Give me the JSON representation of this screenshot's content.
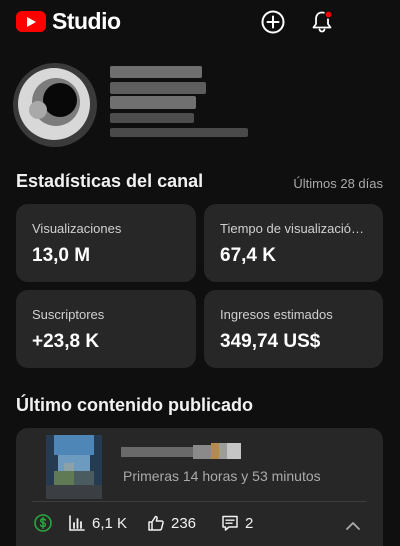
{
  "app": {
    "logo_text": "Studio"
  },
  "header": {
    "create_icon": "plus-circle-icon",
    "notifications_icon": "bell-icon",
    "notification_dot_color": "#ff0000"
  },
  "analytics": {
    "title": "Estadísticas del canal",
    "range": "Últimos 28 días",
    "cards": [
      {
        "label": "Visualizaciones",
        "value": "13,0 M"
      },
      {
        "label": "Tiempo de visualización (horas)",
        "value": "67,4 K"
      },
      {
        "label": "Suscriptores",
        "value": "+23,8 K"
      },
      {
        "label": "Ingresos estimados",
        "value": "349,74 US$"
      }
    ]
  },
  "latest": {
    "title": "Último contenido publicado",
    "published": "Primeras 14 horas y 53 minutos",
    "views": "6,1 K",
    "likes": "236",
    "comments": "2",
    "monetization_color": "#2ba640"
  }
}
